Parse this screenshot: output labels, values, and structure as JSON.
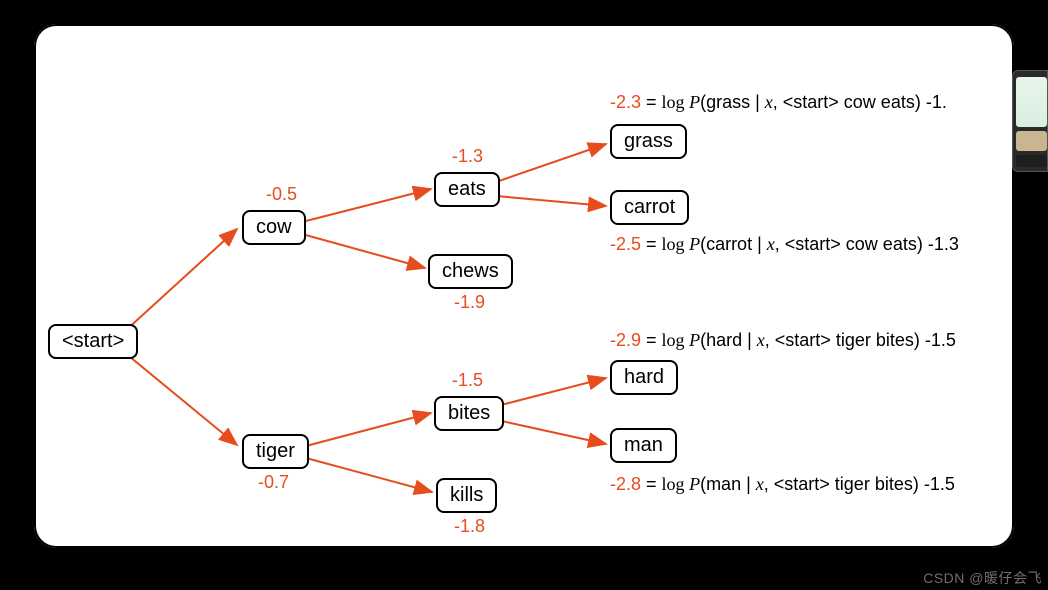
{
  "watermark": "CSDN @暖仔会飞",
  "colors": {
    "accent": "#e74c1c"
  },
  "nodes": {
    "start": {
      "label": "<start>"
    },
    "cow": {
      "label": "cow",
      "score": "-0.5"
    },
    "tiger": {
      "label": "tiger",
      "score": "-0.7"
    },
    "eats": {
      "label": "eats",
      "score": "-1.3"
    },
    "chews": {
      "label": "chews",
      "score": "-1.9"
    },
    "bites": {
      "label": "bites",
      "score": "-1.5"
    },
    "kills": {
      "label": "kills",
      "score": "-1.8"
    },
    "grass": {
      "label": "grass"
    },
    "carrot": {
      "label": "carrot"
    },
    "hard": {
      "label": "hard"
    },
    "man": {
      "label": "man"
    }
  },
  "formulas": {
    "grass": {
      "lead": "-2.3",
      "eq": " = ",
      "log": "log ",
      "P": "P",
      "open": "(",
      "arg": "grass | ",
      "x": "x",
      "ctx": ", <start> cow eats",
      "close": ")",
      "tail": " -1."
    },
    "carrot": {
      "lead": "-2.5",
      "eq": " = ",
      "log": "log ",
      "P": "P",
      "open": "(",
      "arg": "carrot | ",
      "x": "x",
      "ctx": ", <start> cow eats",
      "close": ")",
      "tail": " -1.3"
    },
    "hard": {
      "lead": "-2.9",
      "eq": " = ",
      "log": "log ",
      "P": "P",
      "open": "(",
      "arg": "hard | ",
      "x": "x",
      "ctx": ", <start> tiger bites",
      "close": ")",
      "tail": " -1.5"
    },
    "man": {
      "lead": "-2.8",
      "eq": " = ",
      "log": "log ",
      "P": "P",
      "open": "(",
      "arg": "man | ",
      "x": "x",
      "ctx": ", <start> tiger bites",
      "close": ")",
      "tail": " -1.5"
    }
  },
  "edges": [
    {
      "from": "start",
      "to": "cow"
    },
    {
      "from": "start",
      "to": "tiger"
    },
    {
      "from": "cow",
      "to": "eats"
    },
    {
      "from": "cow",
      "to": "chews"
    },
    {
      "from": "tiger",
      "to": "bites"
    },
    {
      "from": "tiger",
      "to": "kills"
    },
    {
      "from": "eats",
      "to": "grass"
    },
    {
      "from": "eats",
      "to": "carrot"
    },
    {
      "from": "bites",
      "to": "hard"
    },
    {
      "from": "bites",
      "to": "man"
    }
  ]
}
